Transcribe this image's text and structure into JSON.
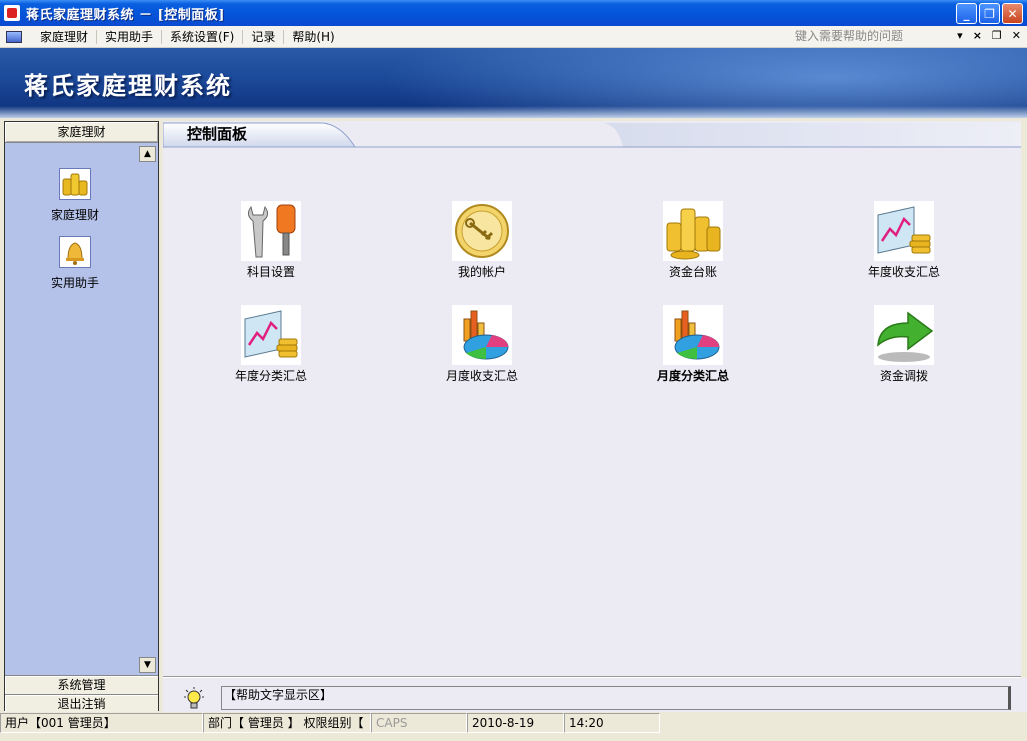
{
  "window": {
    "title": "蒋氏家庭理财系统 － [控制面板]",
    "buttons": {
      "minimize": "_",
      "restore": "❐",
      "close": "✕"
    }
  },
  "menu": {
    "items": [
      "家庭理财",
      "实用助手",
      "系统设置(F)",
      "记录",
      "帮助(H)"
    ],
    "help_placeholder": "键入需要帮助的问题",
    "right_controls": [
      "▾",
      "×",
      "❐",
      "✕"
    ]
  },
  "banner": {
    "brand": "蒋氏家庭理财系统"
  },
  "sidebar": {
    "header": "家庭理财",
    "items": [
      {
        "label": "家庭理财",
        "icon": "coins-icon"
      },
      {
        "label": "实用助手",
        "icon": "bell-icon"
      }
    ],
    "footers": [
      "系统管理",
      "退出注销"
    ]
  },
  "panel": {
    "title": "控制面板",
    "items": [
      {
        "label": "科目设置",
        "icon": "tools-icon"
      },
      {
        "label": "我的帐户",
        "icon": "key-icon"
      },
      {
        "label": "资金台账",
        "icon": "coins-stack-icon"
      },
      {
        "label": "年度收支汇总",
        "icon": "chart-coins-icon"
      },
      {
        "label": "年度分类汇总",
        "icon": "chart-coins-icon"
      },
      {
        "label": "月度收支汇总",
        "icon": "pie-bar-icon"
      },
      {
        "label": "月度分类汇总",
        "icon": "pie-bar-icon"
      },
      {
        "label": "资金调拨",
        "icon": "green-arrow-icon"
      }
    ]
  },
  "help": {
    "text": "【帮助文字显示区】"
  },
  "status": {
    "user": "用户【001 管理员】",
    "dept": "部门【 管理员 】 权限组别【",
    "caps": "CAPS",
    "date": "2010-8-19",
    "time": "14:20"
  }
}
